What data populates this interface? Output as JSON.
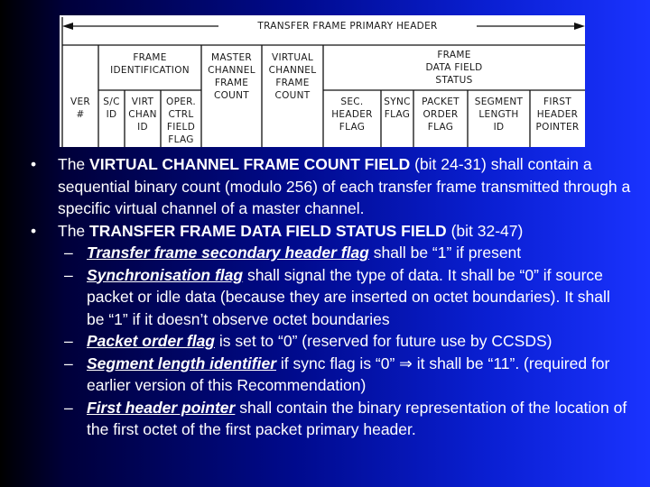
{
  "diagram": {
    "banner": "TRANSFER FRAME PRIMARY HEADER",
    "groups": {
      "frame_identification": "FRAME\nIDENTIFICATION",
      "master_channel_frame_count": "MASTER\nCHANNEL\nFRAME\nCOUNT",
      "virtual_channel_frame_count": "VIRTUAL\nCHANNEL\nFRAME\nCOUNT",
      "frame_data_field_status": "FRAME\nDATA FIELD\nSTATUS"
    },
    "fields": {
      "ver": "VER\n#",
      "sc_id": "S/C\nID",
      "virt_chan_id": "VIRT\nCHAN\nID",
      "oper_ctrl_field_flag": "OPER.\nCTRL\nFIELD\nFLAG",
      "sec_header_flag": "SEC.\nHEADER\nFLAG",
      "sync_flag": "SYNC\nFLAG",
      "packet_order_flag": "PACKET\nORDER\nFLAG",
      "segment_length_id": "SEGMENT\nLENGTH\nID",
      "first_header_pointer": "FIRST\nHEADER\nPOINTER"
    }
  },
  "bullets": [
    {
      "prefix": "The ",
      "bold": "VIRTUAL CHANNEL FRAME COUNT FIELD",
      "suffix": " (bit 24-31) shall contain a sequential binary count (modulo 256) of each transfer frame transmitted through a specific virtual channel of a master channel."
    },
    {
      "prefix": "The ",
      "bold": "TRANSFER FRAME DATA FIELD STATUS FIELD",
      "suffix": " (bit 32-47)"
    }
  ],
  "sub_bullets": [
    {
      "term": "Transfer frame secondary header flag",
      "text": " shall be “1” if present"
    },
    {
      "term": "Synchronisation flag",
      "text": " shall signal the type of data. It shall be “0” if source packet or idle data (because they are inserted on octet boundaries). It shall be “1” if it doesn’t observe octet boundaries"
    },
    {
      "term": "Packet order flag",
      "text": " is set to “0” (reserved for future use by CCSDS)"
    },
    {
      "term": "Segment length identifier",
      "text": " if sync flag is “0” ⇒ it shall be “11”. (required for earlier version of this Recommendation)"
    },
    {
      "term": "First header pointer",
      "text": " shall contain the binary representation of the location of the first octet of the first packet primary header."
    }
  ],
  "symbols": {
    "bullet": "•",
    "dash": "–"
  }
}
